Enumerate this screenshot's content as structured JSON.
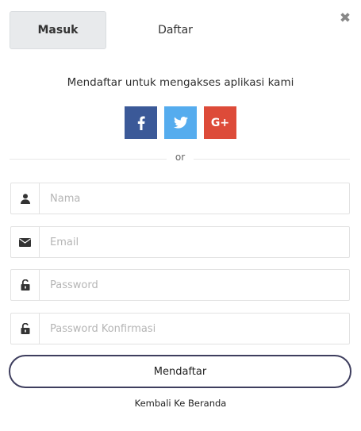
{
  "close": {
    "glyph": "✖"
  },
  "tabs": [
    {
      "label": "Masuk",
      "active": true
    },
    {
      "label": "Daftar",
      "active": false
    }
  ],
  "subtitle": "Mendaftar untuk mengakses aplikasi kami",
  "social": {
    "facebook": {
      "icon": "facebook-icon",
      "color": "#3b5998"
    },
    "twitter": {
      "icon": "twitter-icon",
      "color": "#55acee"
    },
    "google": {
      "label": "G+",
      "icon": "google-plus-icon",
      "color": "#dd4b39"
    }
  },
  "divider_text": "or",
  "fields": [
    {
      "icon": "user-icon",
      "placeholder": "Nama",
      "value": ""
    },
    {
      "icon": "envelope-icon",
      "placeholder": "Email",
      "value": ""
    },
    {
      "icon": "unlock-icon",
      "placeholder": "Password",
      "value": ""
    },
    {
      "icon": "unlock-icon",
      "placeholder": "Password Konfirmasi",
      "value": ""
    }
  ],
  "submit_label": "Mendaftar",
  "back_link": "Kembali Ke Beranda",
  "colors": {
    "button_border": "#3e3e5e",
    "icon": "#333333"
  }
}
